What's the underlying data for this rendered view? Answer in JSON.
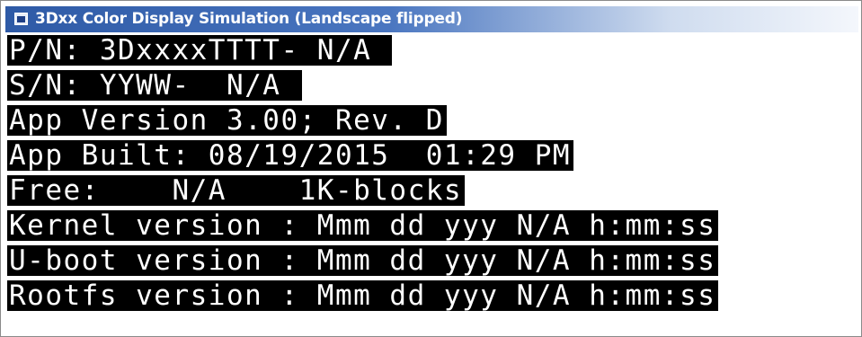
{
  "window": {
    "title": "3Dxx Color Display Simulation (Landscape flipped)",
    "icon": "app-window-icon"
  },
  "display": {
    "lines": [
      "P/N: 3DxxxxTTTT- N/A ",
      "S/N: YYWW-  N/A ",
      "App Version 3.00; Rev. D",
      "App Built: 08/19/2015  01:29 PM",
      "Free:    N/A    1K-blocks",
      "Kernel version : Mmm dd yyy N/A h:mm:ss",
      "U-boot version : Mmm dd yyy N/A h:mm:ss",
      "Rootfs version : Mmm dd yyy N/A h:mm:ss"
    ]
  },
  "colors": {
    "text": "#ffffff",
    "text_background": "#000000",
    "titlebar_start": "#2e5aa6",
    "titlebar_end": "#f4f7fc"
  }
}
